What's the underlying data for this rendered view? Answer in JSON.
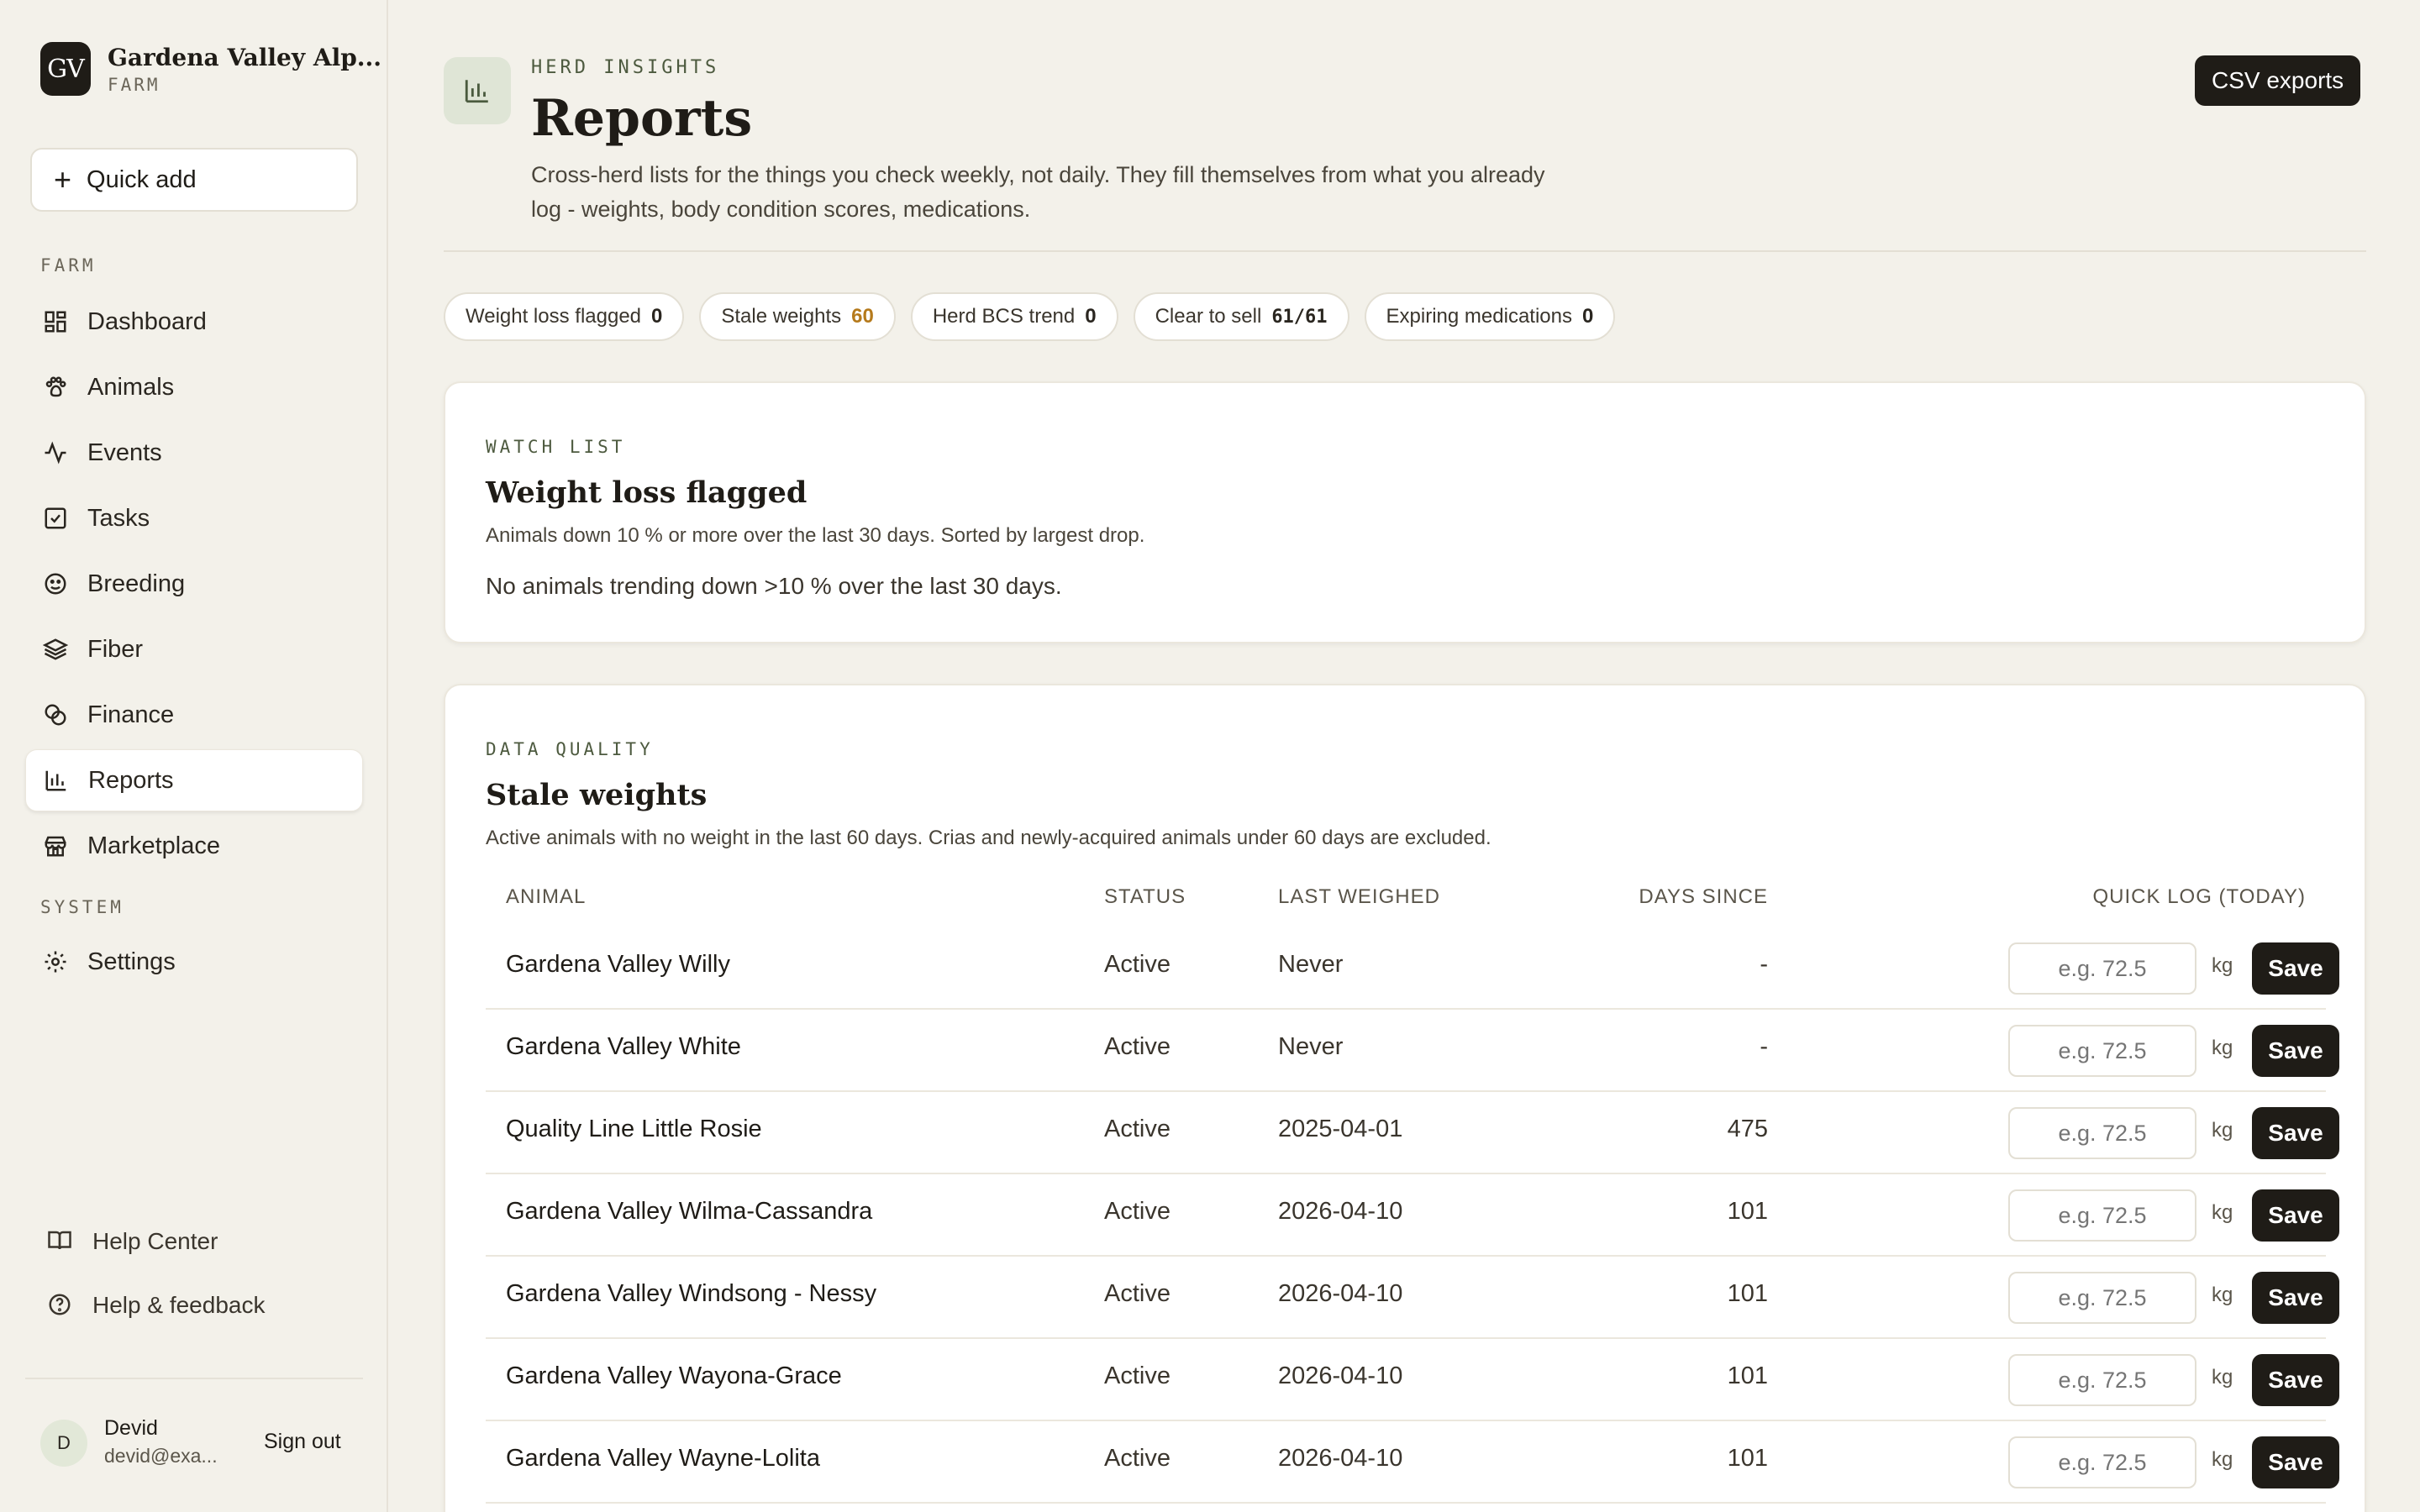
{
  "brand": {
    "initials": "GV",
    "name": "Gardena Valley Alp...",
    "sub": "FARM"
  },
  "sidebar": {
    "quick_add": "Quick add",
    "section_farm": "FARM",
    "section_system": "SYSTEM",
    "items": [
      {
        "label": "Dashboard",
        "icon": "dashboard-icon"
      },
      {
        "label": "Animals",
        "icon": "paw-icon"
      },
      {
        "label": "Events",
        "icon": "activity-icon"
      },
      {
        "label": "Tasks",
        "icon": "checkbox-icon"
      },
      {
        "label": "Breeding",
        "icon": "smile-icon"
      },
      {
        "label": "Fiber",
        "icon": "layers-icon"
      },
      {
        "label": "Finance",
        "icon": "coins-icon"
      },
      {
        "label": "Reports",
        "icon": "bar-chart-icon",
        "active": true
      },
      {
        "label": "Marketplace",
        "icon": "store-icon"
      }
    ],
    "settings": "Settings",
    "help_center": "Help Center",
    "help_feedback": "Help & feedback",
    "user": {
      "initial": "D",
      "name": "Devid",
      "email": "devid@exa...",
      "sign_out": "Sign out"
    }
  },
  "header": {
    "eyebrow": "HERD INSIGHTS",
    "title": "Reports",
    "description": "Cross-herd lists for the things you check weekly, not daily. They fill themselves from what you already log - weights, body condition scores, medications.",
    "csv_button": "CSV exports"
  },
  "chips": [
    {
      "label": "Weight loss flagged",
      "count": "0"
    },
    {
      "label": "Stale weights",
      "count": "60"
    },
    {
      "label": "Herd BCS trend",
      "count": "0"
    },
    {
      "label": "Clear to sell",
      "count": "61/61"
    },
    {
      "label": "Expiring medications",
      "count": "0"
    }
  ],
  "watch_list": {
    "eyebrow": "WATCH LIST",
    "title": "Weight loss flagged",
    "subtitle": "Animals down 10 % or more over the last 30 days. Sorted by largest drop.",
    "empty": "No animals trending down >10 % over the last 30 days."
  },
  "stale_weights": {
    "eyebrow": "DATA QUALITY",
    "title": "Stale weights",
    "subtitle": "Active animals with no weight in the last 60 days. Crias and newly-acquired animals under 60 days are excluded.",
    "columns": {
      "animal": "ANIMAL",
      "status": "STATUS",
      "last_weighed": "LAST WEIGHED",
      "days_since": "DAYS SINCE",
      "quick_log": "QUICK LOG (TODAY)"
    },
    "placeholder": "e.g. 72.5",
    "unit": "kg",
    "save": "Save",
    "rows": [
      {
        "name": "Gardena Valley Willy",
        "status": "Active",
        "last": "Never",
        "days": "-"
      },
      {
        "name": "Gardena Valley White",
        "status": "Active",
        "last": "Never",
        "days": "-"
      },
      {
        "name": "Quality Line Little Rosie",
        "status": "Active",
        "last": "2025-04-01",
        "days": "475"
      },
      {
        "name": "Gardena Valley Wilma-Cassandra",
        "status": "Active",
        "last": "2026-04-10",
        "days": "101"
      },
      {
        "name": "Gardena Valley Windsong - Nessy",
        "status": "Active",
        "last": "2026-04-10",
        "days": "101"
      },
      {
        "name": "Gardena Valley Wayona-Grace",
        "status": "Active",
        "last": "2026-04-10",
        "days": "101"
      },
      {
        "name": "Gardena Valley Wayne-Lolita",
        "status": "Active",
        "last": "2026-04-10",
        "days": "101"
      }
    ]
  }
}
